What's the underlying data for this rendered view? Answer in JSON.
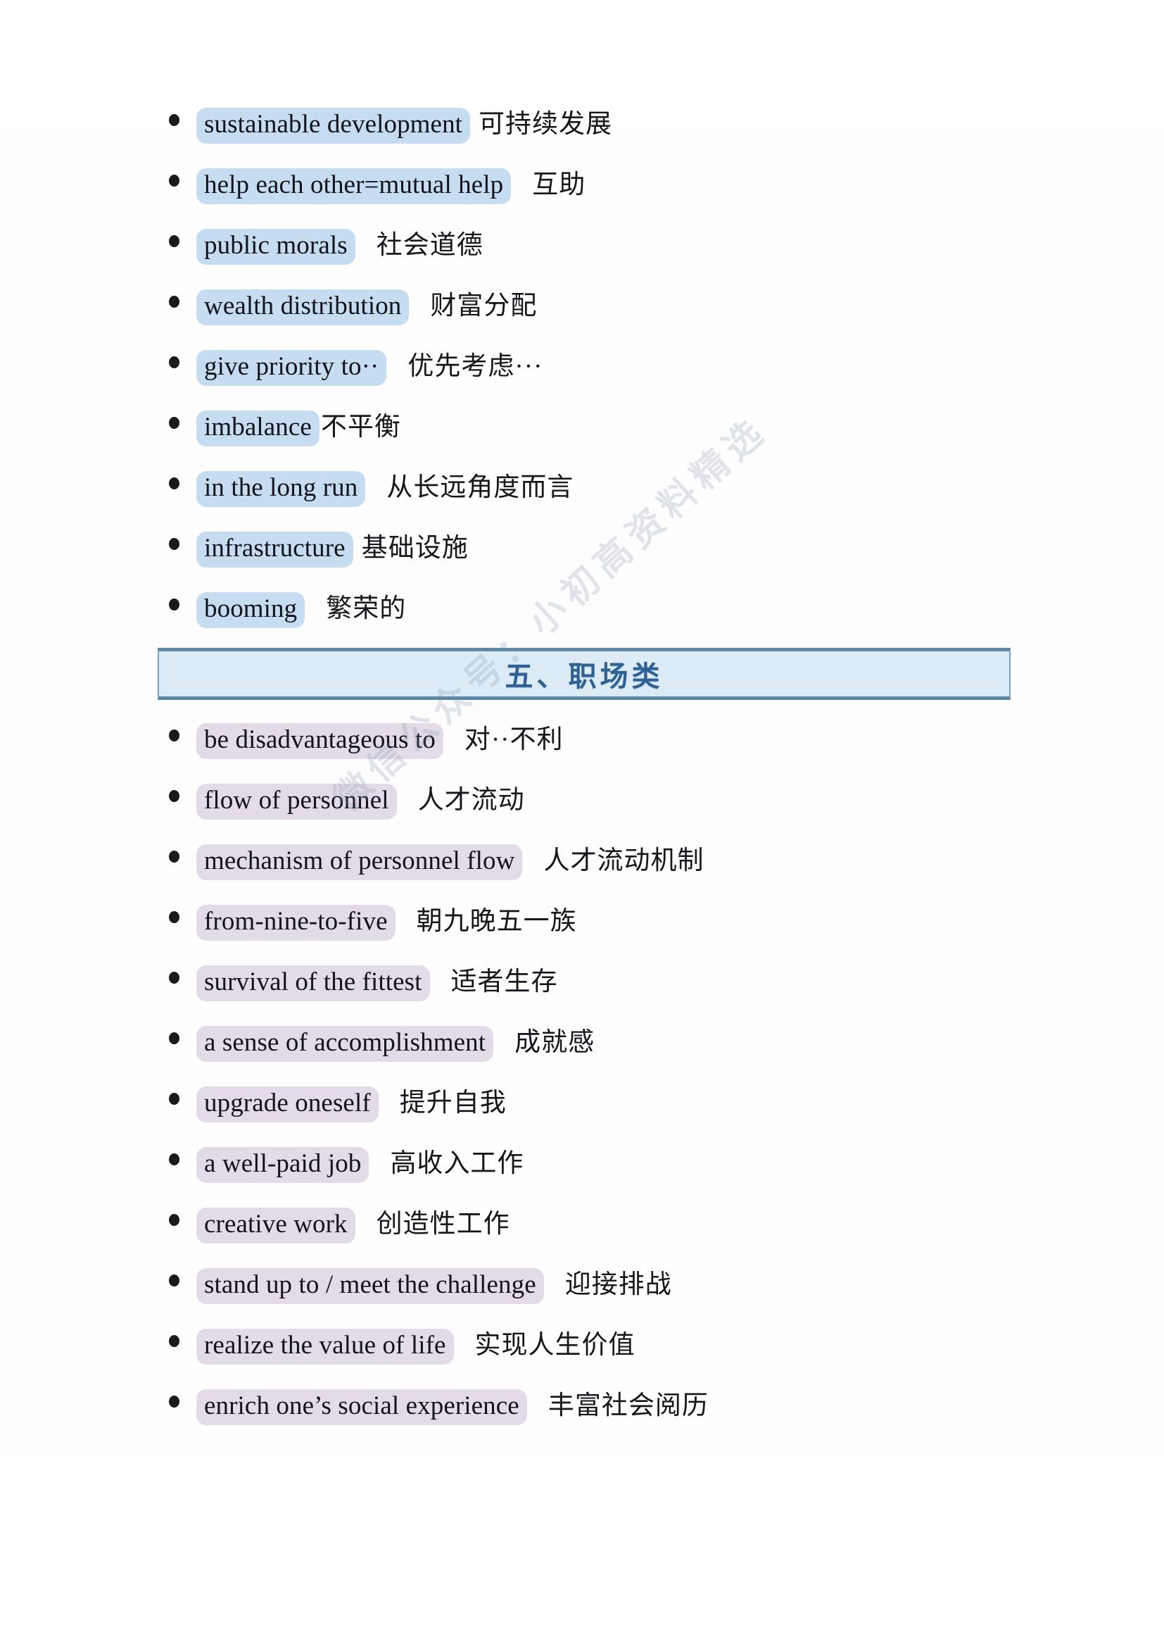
{
  "page": {
    "background_color": "#ffffff",
    "highlight_blue": "#c6dcf0",
    "highlight_purple": "#e4dbe8",
    "banner_fill": "#dcebf5",
    "banner_border": "#5b87a8",
    "banner_text_color": "#2f6293"
  },
  "watermark": {
    "text": "微信公众号：小初高资料精选"
  },
  "sections": [
    {
      "id": "society-continued",
      "banner": null,
      "highlight": "blue",
      "items": [
        {
          "term": "sustainable development",
          "meaning": "可持续发展",
          "gap": "normal"
        },
        {
          "term": "help each other=mutual help",
          "meaning": "互助",
          "gap": "wide"
        },
        {
          "term": "public morals",
          "meaning": "社会道德",
          "gap": "wide"
        },
        {
          "term": "wealth distribution",
          "meaning": "财富分配",
          "gap": "wide"
        },
        {
          "term": "give priority to··",
          "meaning": "优先考虑···",
          "gap": "wide"
        },
        {
          "term": "imbalance",
          "meaning": "不平衡",
          "gap": "none"
        },
        {
          "term": "in the long run",
          "meaning": "从长远角度而言",
          "gap": "wide"
        },
        {
          "term": "infrastructure",
          "meaning": "基础设施",
          "gap": "normal"
        },
        {
          "term": "booming",
          "meaning": "繁荣的",
          "gap": "wide"
        }
      ]
    },
    {
      "id": "workplace",
      "banner": "五、职场类",
      "highlight": "purple",
      "items": [
        {
          "term": "be disadvantageous to",
          "meaning": "对··不利",
          "gap": "wide"
        },
        {
          "term": "flow of personnel",
          "meaning": "人才流动",
          "gap": "wide"
        },
        {
          "term": "mechanism of personnel flow",
          "meaning": "人才流动机制",
          "gap": "wide"
        },
        {
          "term": "from-nine-to-five",
          "meaning": "朝九晚五一族",
          "gap": "wide"
        },
        {
          "term": "survival of the fittest",
          "meaning": "适者生存",
          "gap": "wide"
        },
        {
          "term": "a sense of accomplishment",
          "meaning": "成就感",
          "gap": "wide"
        },
        {
          "term": "upgrade oneself",
          "meaning": "提升自我",
          "gap": "wide"
        },
        {
          "term": "a well-paid job",
          "meaning": "高收入工作",
          "gap": "wide"
        },
        {
          "term": "creative work",
          "meaning": "创造性工作",
          "gap": "wide"
        },
        {
          "term": "stand up to / meet the challenge",
          "meaning": "迎接排战",
          "gap": "wide"
        },
        {
          "term": "realize the value of life",
          "meaning": "实现人生价值",
          "gap": "wide"
        },
        {
          "term": "enrich one’s social experience",
          "meaning": "丰富社会阅历",
          "gap": "wide"
        }
      ]
    }
  ]
}
